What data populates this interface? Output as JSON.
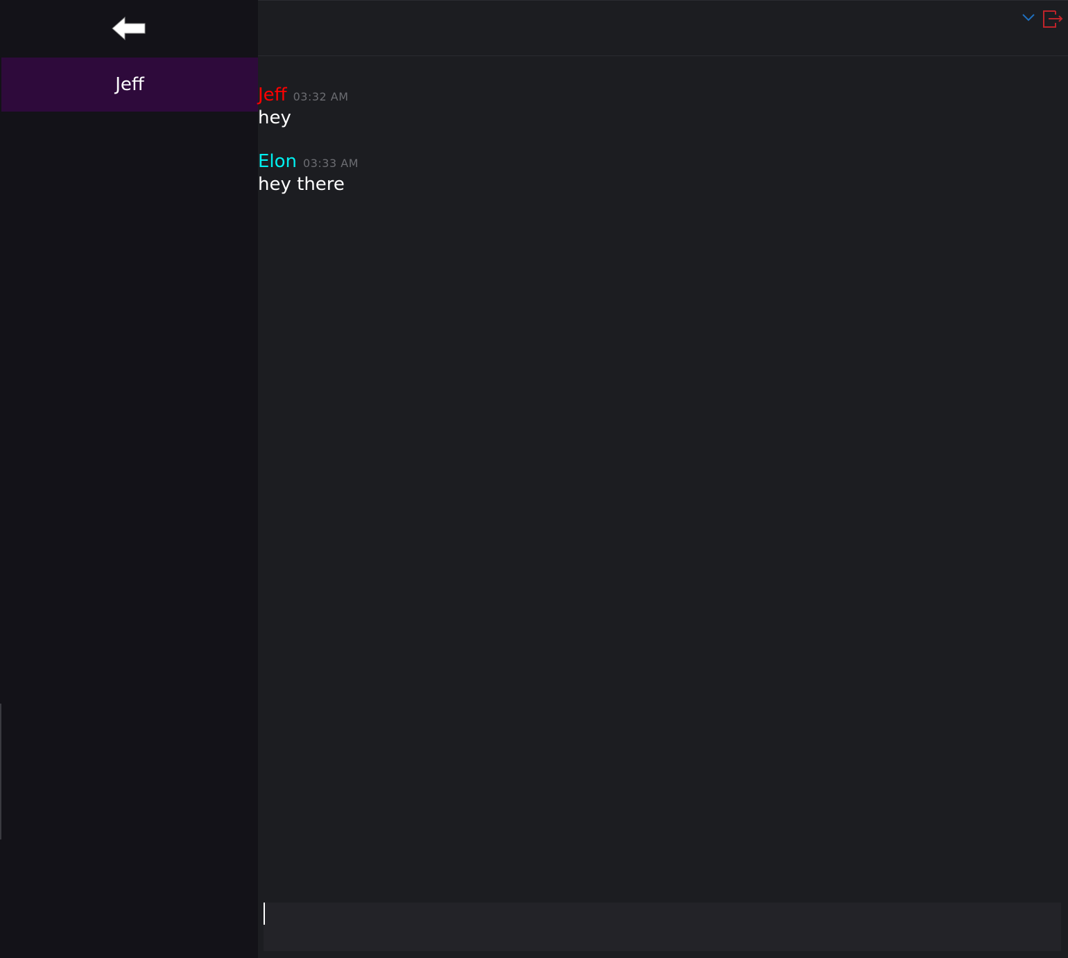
{
  "sidebar": {
    "back_icon": "arrow-left-icon",
    "contacts": [
      {
        "label": "Jeff",
        "selected": true
      }
    ]
  },
  "header": {
    "chevron_icon": "chevron-down-icon",
    "logout_icon": "logout-icon"
  },
  "messages": [
    {
      "author": "Jeff",
      "time": "03:32 AM",
      "text": "hey",
      "color": "#ff0000"
    },
    {
      "author": "Elon",
      "time": "03:33 AM",
      "text": "hey there",
      "color": "#00f0f0"
    }
  ],
  "composer": {
    "value": "",
    "placeholder": ""
  },
  "colors": {
    "sidebar_bg": "#131218",
    "selected_contact_bg": "#2e0a3b",
    "main_bg": "#1c1d21",
    "composer_bg": "#232328",
    "chevron": "#1e6fbf",
    "logout": "#c0242a"
  }
}
